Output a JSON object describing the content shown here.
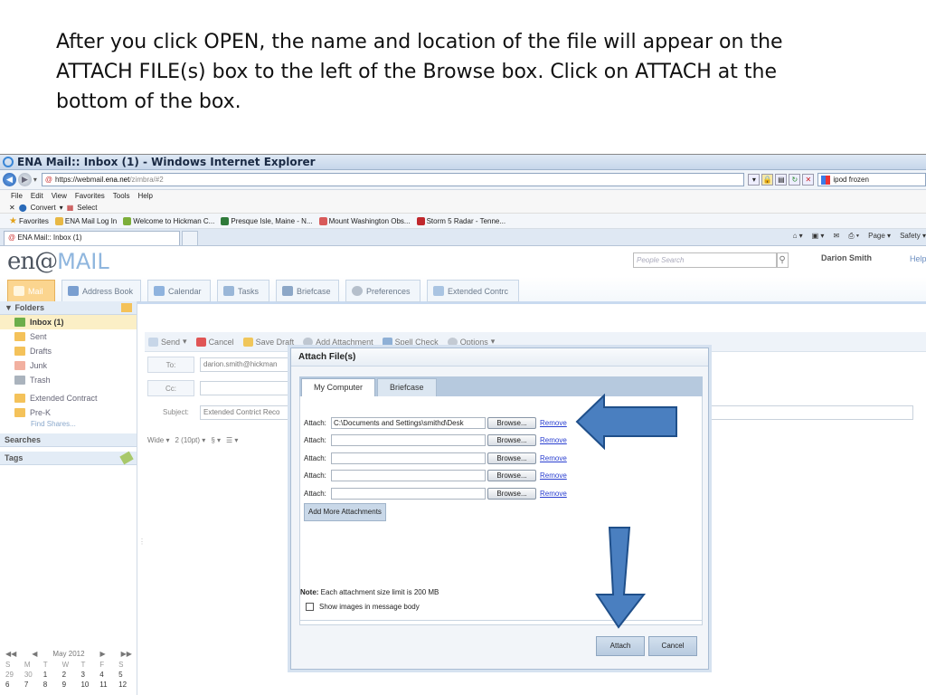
{
  "caption": "After you click OPEN, the name and location of the file will appear on the ATTACH FILE(s) box to the left of the Browse box.   Click on ATTACH at the bottom of the box.",
  "window": {
    "title": "ENA Mail:: Inbox (1) - Windows Internet Explorer",
    "url_prefix": "https://webmail.",
    "url_domain": "ena.net",
    "url_path": "/zimbra/#2",
    "search_value": "ipod frozen"
  },
  "menu": [
    "File",
    "Edit",
    "View",
    "Favorites",
    "Tools",
    "Help"
  ],
  "command": {
    "convert": "Convert",
    "select": "Select"
  },
  "favorites": {
    "label": "Favorites",
    "items": [
      "ENA Mail Log In",
      "Welcome to Hickman C...",
      "Presque Isle, Maine - N...",
      "Mount Washington Obs...",
      "Storm 5 Radar - Tenne..."
    ]
  },
  "tab": {
    "title": "ENA Mail:: Inbox (1)",
    "tools": [
      "Page",
      "Safety"
    ]
  },
  "zimbra": {
    "logo_en": "en@",
    "logo_mail": "MAIL",
    "search_placeholder": "People Search",
    "user": "Darion Smith",
    "help": "Help",
    "apptabs": [
      "Mail",
      "Address Book",
      "Calendar",
      "Tasks",
      "Briefcase",
      "Preferences",
      "Extended Contrc"
    ]
  },
  "left": {
    "folders_header": "Folders",
    "folders": [
      "Inbox (1)",
      "Sent",
      "Drafts",
      "Junk",
      "Trash",
      "Extended Contract",
      "Pre-K"
    ],
    "find_shares": "Find Shares...",
    "searches": "Searches",
    "tags": "Tags",
    "calendar": {
      "month": "May 2012",
      "days": [
        "S",
        "M",
        "T",
        "W",
        "T",
        "F",
        "S"
      ],
      "row1": [
        "29",
        "30",
        "1",
        "2",
        "3",
        "4",
        "5"
      ],
      "row2": [
        "6",
        "7",
        "8",
        "9",
        "10",
        "11",
        "12"
      ]
    }
  },
  "compose": {
    "toolbar": [
      "Send",
      "Cancel",
      "Save Draft",
      "Add Attachment",
      "Spell Check",
      "Options"
    ],
    "to_label": "To:",
    "to_value": "darion.smith@hickman",
    "cc_label": "Cc:",
    "subject_label": "Subject:",
    "subject_value": "Extended Contrict Reco",
    "format": [
      "Wide",
      "2 (10pt)",
      "§"
    ]
  },
  "dialog": {
    "title": "Attach File(s)",
    "tabs": [
      "My Computer",
      "Briefcase"
    ],
    "attach_label": "Attach:",
    "first_file": "C:\\Documents and Settings\\smithd\\Desk",
    "browse": "Browse...",
    "remove": "Remove",
    "add_more": "Add More Attachments",
    "note_bold": "Note:",
    "note_text": " Each attachment size limit is 200 MB",
    "show_images": "Show images in message body",
    "attach_button": "Attach",
    "cancel_button": "Cancel"
  },
  "colors": {
    "accent": "#2f6db3",
    "arrow_fill": "#4a7fc0",
    "arrow_stroke": "#1f4f8a"
  }
}
